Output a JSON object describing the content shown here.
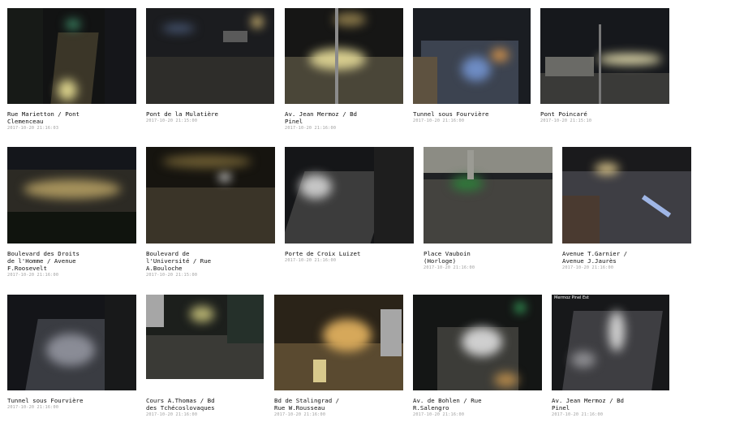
{
  "cameras": [
    {
      "name": "Rue Marietton / Pont\nClemenceau",
      "timestamp": "2017-10-20 21:16:03"
    },
    {
      "name": "Pont de la Mulatière",
      "timestamp": "2017-10-20 21:15:00"
    },
    {
      "name": "Av. Jean Mermoz / Bd\nPinel",
      "timestamp": "2017-10-20 21:16:00"
    },
    {
      "name": "Tunnel sous Fourvière",
      "timestamp": "2017-10-20 21:16:00"
    },
    {
      "name": "Pont Poincaré",
      "timestamp": "2017-10-20 21:15:10"
    },
    {
      "name": "Boulevard des Droits\nde l'Homme / Avenue\nF.Roosevelt",
      "timestamp": "2017-10-20 21:16:00"
    },
    {
      "name": "Boulevard de\nl'Université / Rue\nA.Bouloche",
      "timestamp": "2017-10-20 21:15:00"
    },
    {
      "name": "Porte de Croix Luizet",
      "timestamp": "2017-10-20 21:16:00"
    },
    {
      "name": "Place Vauboin\n(Horloge)",
      "timestamp": "2017-10-20 21:16:00"
    },
    {
      "name": "Avenue T.Garnier /\nAvenue J.Jaurès",
      "timestamp": "2017-10-20 21:16:00"
    },
    {
      "name": "Tunnel sous Fourvière",
      "timestamp": "2017-10-20 21:16:00"
    },
    {
      "name": "Cours A.Thomas / Bd\ndes Tchécoslovaques",
      "timestamp": "2017-10-20 21:16:00"
    },
    {
      "name": "Bd de Stalingrad /\nRue W.Rousseau",
      "timestamp": "2017-10-20 21:16:00"
    },
    {
      "name": "Av. de Bohlen / Rue\nR.Salengro",
      "timestamp": "2017-10-20 21:16:00"
    },
    {
      "name": "Av. Jean Mermoz / Bd\nPinel",
      "timestamp": "2017-10-20 21:16:00"
    }
  ],
  "overlay": {
    "camera15": "Mermoz Pinel Est"
  }
}
